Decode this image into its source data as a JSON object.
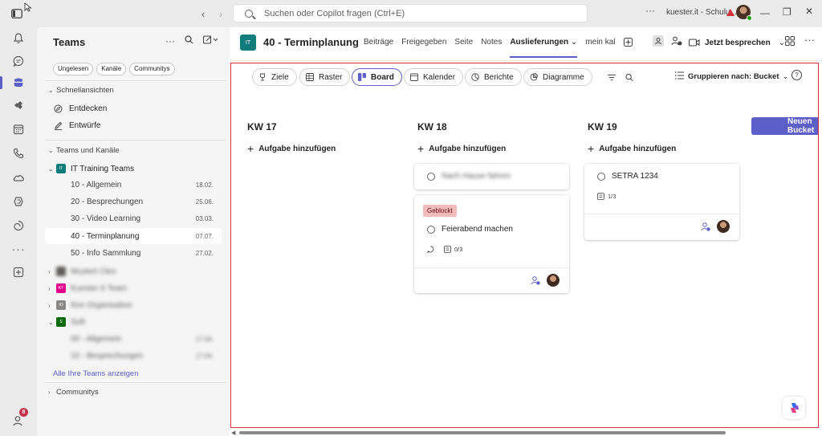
{
  "titlebar": {
    "search_placeholder": "Suchen oder Copilot fragen (Ctrl+E)",
    "account": "kuester.it - Schulu...",
    "more": "···"
  },
  "rail": {
    "notify_count": "8"
  },
  "sidebar": {
    "title": "Teams",
    "chips": [
      "Ungelesen",
      "Kanäle",
      "Communitys"
    ],
    "quick_views_label": "Schnellansichten",
    "discover": "Entdecken",
    "drafts": "Entwürfe",
    "teams_channels_label": "Teams und Kanäle",
    "team_name": "IT Training Teams",
    "team_abbr": "IT",
    "channels": [
      {
        "name": "10 - Allgemein",
        "date": "18.02."
      },
      {
        "name": "20 - Besprechungen",
        "date": "25.06."
      },
      {
        "name": "30 - Video Learning",
        "date": "03.03."
      },
      {
        "name": "40 - Terminplanung",
        "date": "07.07."
      },
      {
        "name": "50 - Info Sammlung",
        "date": "27.02."
      }
    ],
    "blurred_teams": [
      {
        "name": "Mustert Cleo",
        "abbr": "MC",
        "color": "#605e5c"
      },
      {
        "name": "Kuester It Team",
        "abbr": "KT",
        "color": "#e3008c"
      },
      {
        "name": "Ihre Organisation",
        "abbr": "IO",
        "color": "#8a8886"
      },
      {
        "name": "Soft",
        "abbr": "S",
        "color": "#0b6a0b"
      }
    ],
    "blurred_channels": [
      {
        "name": "00 - Allgemein",
        "date": "17.04."
      },
      {
        "name": "10 - Besprechungen",
        "date": "17.04."
      }
    ],
    "show_all": "Alle Ihre Teams anzeigen",
    "communities": "Communitys"
  },
  "channel": {
    "abbr": "IT",
    "title": "40 - Terminplanung",
    "tabs": [
      "Beiträge",
      "Freigegeben",
      "Seite",
      "Notes",
      "Auslieferungen",
      "mein kal"
    ],
    "active_tab": "Auslieferungen",
    "meet_label": "Jetzt besprechen"
  },
  "planner": {
    "views": [
      "Ziele",
      "Raster",
      "Board",
      "Kalender",
      "Berichte",
      "Diagramme"
    ],
    "active_view": "Board",
    "group_by": "Gruppieren nach: Bucket",
    "new_bucket": "Neuen Bucket",
    "add_task": "Aufgabe hinzufügen",
    "buckets": [
      {
        "title": "KW 17"
      },
      {
        "title": "KW 18"
      },
      {
        "title": "KW 19"
      }
    ],
    "cards": {
      "kw18_blurred": "Nach Hause fahren",
      "kw18_label": "Geblockt",
      "kw18_task": "Feierabend machen",
      "kw18_checklist": "0/3",
      "kw19_task": "SETRA 1234",
      "kw19_checklist": "1/3"
    }
  },
  "colors": {
    "accent": "#5b5fc7",
    "frame": "#d13438",
    "blocked_bg": "#f1bbbc"
  }
}
